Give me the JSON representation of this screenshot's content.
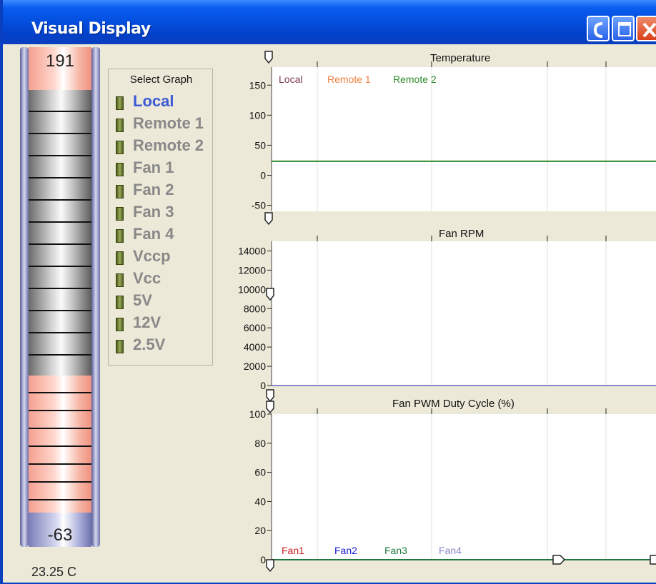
{
  "window": {
    "title": "Visual Display"
  },
  "thermometer": {
    "top_value": "191",
    "bottom_value": "-63",
    "reading": "23.25 C"
  },
  "select_graph": {
    "title": "Select Graph",
    "items": [
      {
        "label": "Local",
        "active": true
      },
      {
        "label": "Remote 1",
        "active": false
      },
      {
        "label": "Remote 2",
        "active": false
      },
      {
        "label": "Fan 1",
        "active": false
      },
      {
        "label": "Fan 2",
        "active": false
      },
      {
        "label": "Fan 3",
        "active": false
      },
      {
        "label": "Fan 4",
        "active": false
      },
      {
        "label": "Vccp",
        "active": false
      },
      {
        "label": "Vcc",
        "active": false
      },
      {
        "label": "5V",
        "active": false
      },
      {
        "label": "12V",
        "active": false
      },
      {
        "label": "2.5V",
        "active": false
      }
    ]
  },
  "colors": {
    "local": "#7a3b52",
    "remote1": "#f08040",
    "remote2": "#2e8b2e",
    "fan1": "#d02020",
    "fan2": "#2020d0",
    "fan3": "#207a40",
    "fan4": "#8a88c8",
    "active_label": "#3d59d6"
  },
  "chart_data": [
    {
      "type": "line",
      "title": "Temperature",
      "ylim": [
        -60,
        180
      ],
      "yticks": [
        150,
        100,
        50,
        0,
        -50
      ],
      "grid": true,
      "series": [
        {
          "name": "Local",
          "color": "#7a3b52",
          "values": []
        },
        {
          "name": "Remote 1",
          "color": "#f08040",
          "values": []
        },
        {
          "name": "Remote 2",
          "color": "#2e8b2e",
          "values": [
            23.25,
            23.25
          ]
        }
      ]
    },
    {
      "type": "line",
      "title": "Fan RPM",
      "ylim": [
        0,
        15000
      ],
      "yticks": [
        14000,
        12000,
        10000,
        8000,
        6000,
        4000,
        2000,
        0
      ],
      "grid": true,
      "series": [
        {
          "name": "",
          "color": "#8a88c8",
          "values": [
            0,
            0
          ]
        }
      ]
    },
    {
      "type": "line",
      "title": "Fan PWM Duty Cycle (%)",
      "ylim": [
        0,
        100
      ],
      "yticks": [
        100,
        80,
        60,
        40,
        20,
        0
      ],
      "grid": true,
      "series": [
        {
          "name": "Fan1",
          "color": "#d02020",
          "values": []
        },
        {
          "name": "Fan2",
          "color": "#2020d0",
          "values": []
        },
        {
          "name": "Fan3",
          "color": "#207a40",
          "values": [
            0,
            0
          ]
        },
        {
          "name": "Fan4",
          "color": "#8a88c8",
          "values": []
        }
      ]
    }
  ]
}
